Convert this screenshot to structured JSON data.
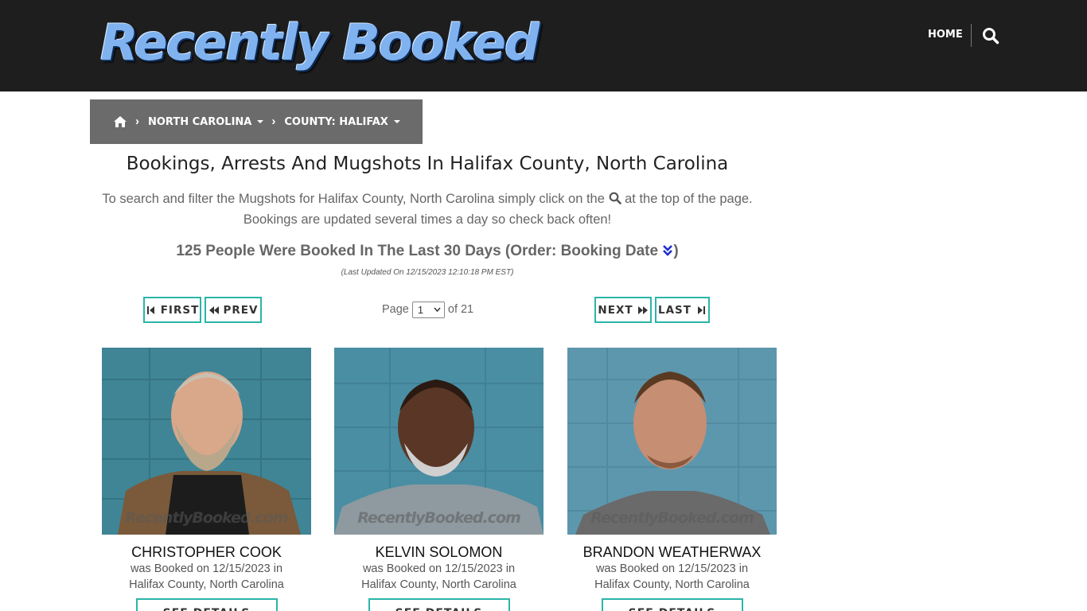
{
  "header": {
    "logo": "Recently Booked",
    "nav_home": "HOME"
  },
  "breadcrumb": {
    "state": "NORTH CAROLINA",
    "county": "COUNTY: HALIFAX"
  },
  "page": {
    "title": "Bookings, Arrests And Mugshots In Halifax County, North Carolina",
    "intro_before_icon": "To search and filter the Mugshots for Halifax County, North Carolina simply click on the",
    "intro_after_icon": "at the top of the page.",
    "intro_line2": "Bookings are updated several times a day so check back often!",
    "count_text": "125 People Were Booked In The Last 30 Days (Order: Booking Date",
    "count_close": ")",
    "last_updated": "(Last Updated On 12/15/2023 12:10:18 PM EST)"
  },
  "pager": {
    "first": "FIRST",
    "prev": "PREV",
    "next": "NEXT",
    "last": "LAST",
    "page_label": "Page",
    "current_page": "1",
    "of_label": "of 21"
  },
  "bookings": [
    {
      "name": "CHRISTOPHER COOK",
      "booked": "was Booked on 12/15/2023 in",
      "location": "Halifax County, North Carolina",
      "button": "SEE DETAILS",
      "watermark": "RecentlyBooked.com"
    },
    {
      "name": "KELVIN SOLOMON",
      "booked": "was Booked on 12/15/2023 in",
      "location": "Halifax County, North Carolina",
      "button": "SEE DETAILS",
      "watermark": "RecentlyBooked.com"
    },
    {
      "name": "BRANDON WEATHERWAX",
      "booked": "was Booked on 12/15/2023 in",
      "location": "Halifax County, North Carolina",
      "button": "SEE DETAILS",
      "watermark": "RecentlyBooked.com"
    }
  ],
  "colors": {
    "header_bg": "#1e1e1e",
    "breadcrumb_bg": "#6b6b6b",
    "button_border": "#2bb5a8",
    "logo_blue": "#7fb2ef",
    "order_icon": "#1f2fd0"
  },
  "icons": {
    "search": "search-icon",
    "home": "home-icon",
    "order": "double-chevron-down-icon",
    "first": "step-backward-icon",
    "prev": "fast-backward-icon",
    "next": "fast-forward-icon",
    "last": "step-forward-icon"
  }
}
